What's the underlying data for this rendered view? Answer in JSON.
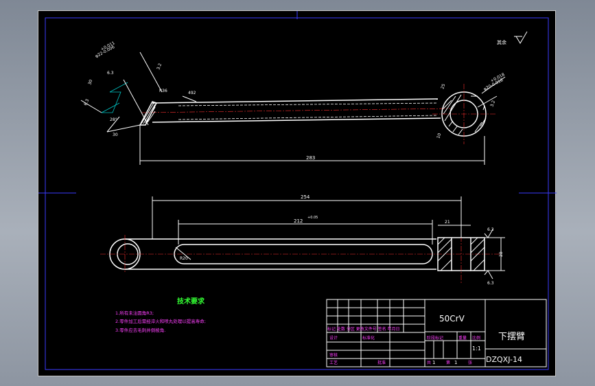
{
  "drawing": {
    "surface_finish_other": "其余",
    "view1": {
      "dim_hole_dia": "φ22-0.006",
      "dim_hole_tol": "+0.011",
      "dim_63_a": "6.3",
      "dim_63_b": "6.3",
      "dim_30_a": "30",
      "dim_30_b": "30",
      "dim_28": "28°",
      "dim_r36": "R36",
      "dim_32": "3.2",
      "dim_492": "492",
      "dim_283": "283",
      "dim_right_dia": "φ20-0.018",
      "dim_right_tol": "+0.018",
      "dim_right_32": "3.2",
      "dim_25": "25",
      "dim_10": "10"
    },
    "view2": {
      "dim_254": "254",
      "dim_212": "212",
      "dim_212_tol": "+0.05",
      "dim_21": "21",
      "dim_63_top": "6.3",
      "dim_63_bot": "6.3",
      "dim_28": "28",
      "dim_r20": "R20"
    },
    "tech": {
      "title": "技术要求",
      "items": [
        "1.所有未注圆角R3;",
        "2.零件加工后需经淬火和喷丸处理以提高寿命;",
        "3.零件应去毛刺并倒棱角."
      ]
    },
    "title_block": {
      "material": "50CrV",
      "part_name": "下摆臂",
      "drawing_no": "DZQXJ-14",
      "scale": "1:1",
      "row_labels": "标记 处数 分区 更改文件号 签名 年月日",
      "design": "设计",
      "standardize": "标准化",
      "stage_mark": "阶段标记",
      "weight": "重量",
      "scale_label": "比例",
      "review": "审核",
      "process": "工艺",
      "approve": "批准",
      "sheets_total": "共",
      "sheets_total_n": "1",
      "sheet_no": "第",
      "sheet_no_n": "1",
      "sheet_unit": "张"
    }
  }
}
